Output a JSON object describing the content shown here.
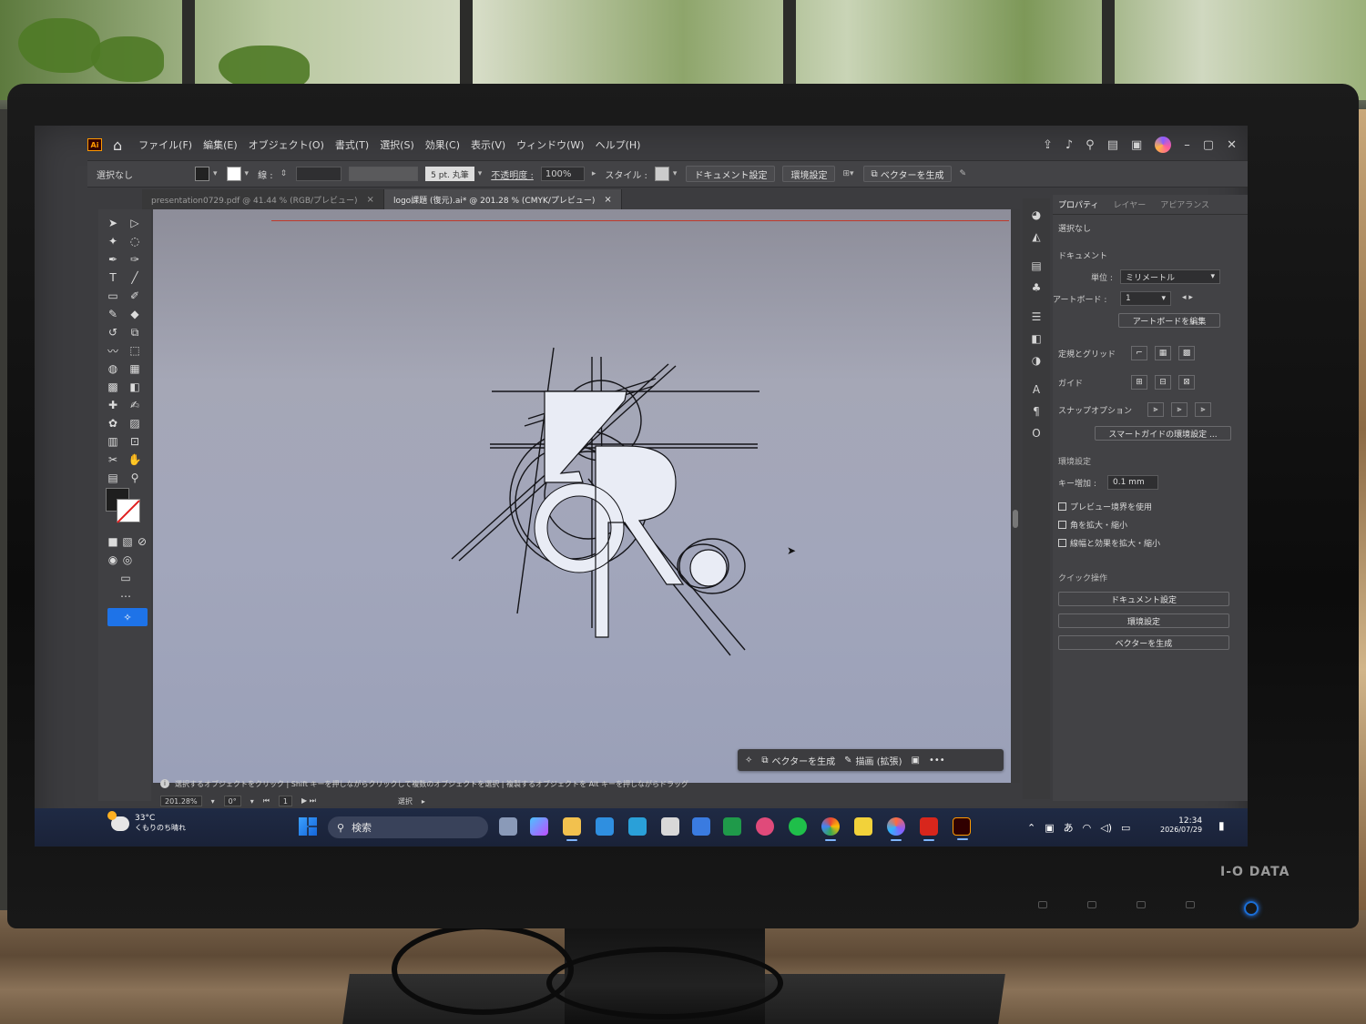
{
  "app": {
    "logo": "Ai"
  },
  "menu": [
    "ファイル(F)",
    "編集(E)",
    "オブジェクト(O)",
    "書式(T)",
    "選択(S)",
    "効果(C)",
    "表示(V)",
    "ウィンドウ(W)",
    "ヘルプ(H)"
  ],
  "control_bar": {
    "selection": "選択なし",
    "stroke_label": "線 :",
    "brush": "5 pt. 丸筆",
    "opacity_label": "不透明度 :",
    "opacity_value": "100%",
    "style_label": "スタイル :",
    "document_setup": "ドキュメント設定",
    "preferences": "環境設定",
    "generate_vectors": "ベクターを生成"
  },
  "tabs": [
    {
      "label": "presentation0729.pdf @ 41.44 % (RGB/プレビュー)",
      "close": "×"
    },
    {
      "label": "logo課題 (復元).ai* @ 201.28 % (CMYK/プレビュー)",
      "close": "×"
    }
  ],
  "context_bar": {
    "generate": "ベクターを生成",
    "draw": "描画 (拡張)",
    "more": "•••"
  },
  "status": {
    "hint": "選択するオブジェクトをクリック | Shift キーを押しながらクリックして複数のオブジェクトを選択 | 複製するオブジェクトを Alt キーを押しながらドラッグ",
    "zoom": "201.28%",
    "rotate": "0°",
    "artboard": "1",
    "mode": "選択"
  },
  "panel": {
    "tabs": [
      "プロパティ",
      "レイヤー",
      "アピアランス"
    ],
    "no_selection": "選択なし",
    "document": "ドキュメント",
    "units_label": "単位 :",
    "units_value": "ミリメートル",
    "artboard_label": "アートボード :",
    "artboard_value": "1",
    "edit_artboards": "アートボードを編集",
    "rulers_grids": "定規とグリッド",
    "guides": "ガイド",
    "snap_options": "スナップオプション",
    "smart_guides": "スマートガイドの環境設定 ...",
    "preferences": "環境設定",
    "key_increment_label": "キー増加 :",
    "key_increment_value": "0.1 mm",
    "chk_preview_bounds": "プレビュー境界を使用",
    "chk_scale_corners": "角を拡大・縮小",
    "chk_scale_strokes": "線幅と効果を拡大・縮小",
    "quick_actions": "クイック操作",
    "qa_document_setup": "ドキュメント設定",
    "qa_preferences": "環境設定",
    "qa_generate": "ベクターを生成"
  },
  "taskbar": {
    "temp": "33°C",
    "weather": "くもりのち晴れ",
    "search": "検索",
    "time": "12:34",
    "date": "2026/07/29",
    "ime": "あ"
  },
  "monitor": {
    "brand": "I-O DATA"
  },
  "colors": {
    "accent": "#1e73e8",
    "canvas": "#a2a6bb",
    "ui": "#424245"
  }
}
